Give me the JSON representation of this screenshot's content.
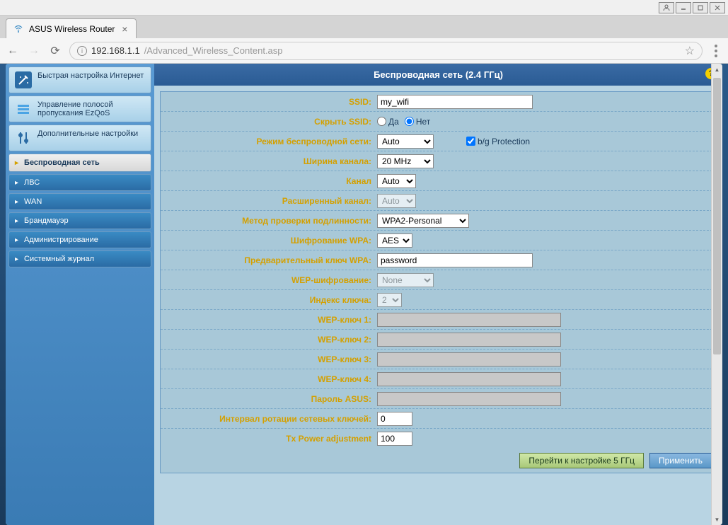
{
  "window": {
    "tab_title": "ASUS Wireless Router",
    "url_host": "192.168.1.1",
    "url_path": "/Advanced_Wireless_Content.asp"
  },
  "sidebar": {
    "items": [
      {
        "label": "Быстрая настройка Интернет",
        "icon": "wand"
      },
      {
        "label": "Управление полосой пропускания EzQoS",
        "icon": "bars"
      },
      {
        "label": "Дополнительные настройки",
        "icon": "tools"
      }
    ],
    "active": "Беспроводная сеть",
    "subs": [
      "ЛВС",
      "WAN",
      "Брандмауэр",
      "Администрирование",
      "Системный журнал"
    ]
  },
  "panel": {
    "title": "Беспроводная сеть (2.4 ГГц)"
  },
  "form": {
    "ssid_label": "SSID:",
    "ssid_value": "my_wifi",
    "hide_ssid_label": "Скрыть SSID:",
    "hide_yes": "Да",
    "hide_no": "Нет",
    "mode_label": "Режим беспроводной сети:",
    "mode_value": "Auto",
    "bg_protection": "b/g Protection",
    "width_label": "Ширина канала:",
    "width_value": "20 MHz",
    "channel_label": "Канал",
    "channel_value": "Auto",
    "ext_channel_label": "Расширенный канал:",
    "ext_channel_value": "Auto",
    "auth_label": "Метод проверки подлинности:",
    "auth_value": "WPA2-Personal",
    "wpa_enc_label": "Шифрование WPA:",
    "wpa_enc_value": "AES",
    "wpa_key_label": "Предварительный ключ WPA:",
    "wpa_key_value": "password",
    "wep_enc_label": "WEP-шифрование:",
    "wep_enc_value": "None",
    "key_index_label": "Индекс ключа:",
    "key_index_value": "2",
    "wep1_label": "WEP-ключ 1:",
    "wep2_label": "WEP-ключ 2:",
    "wep3_label": "WEP-ключ 3:",
    "wep4_label": "WEP-ключ 4:",
    "asus_pass_label": "Пароль ASUS:",
    "rotation_label": "Интервал ротации сетевых ключей:",
    "rotation_value": "0",
    "tx_label": "Tx Power adjustment",
    "tx_value": "100"
  },
  "buttons": {
    "goto5": "Перейти к настройке 5 ГГц",
    "apply": "Применить"
  }
}
